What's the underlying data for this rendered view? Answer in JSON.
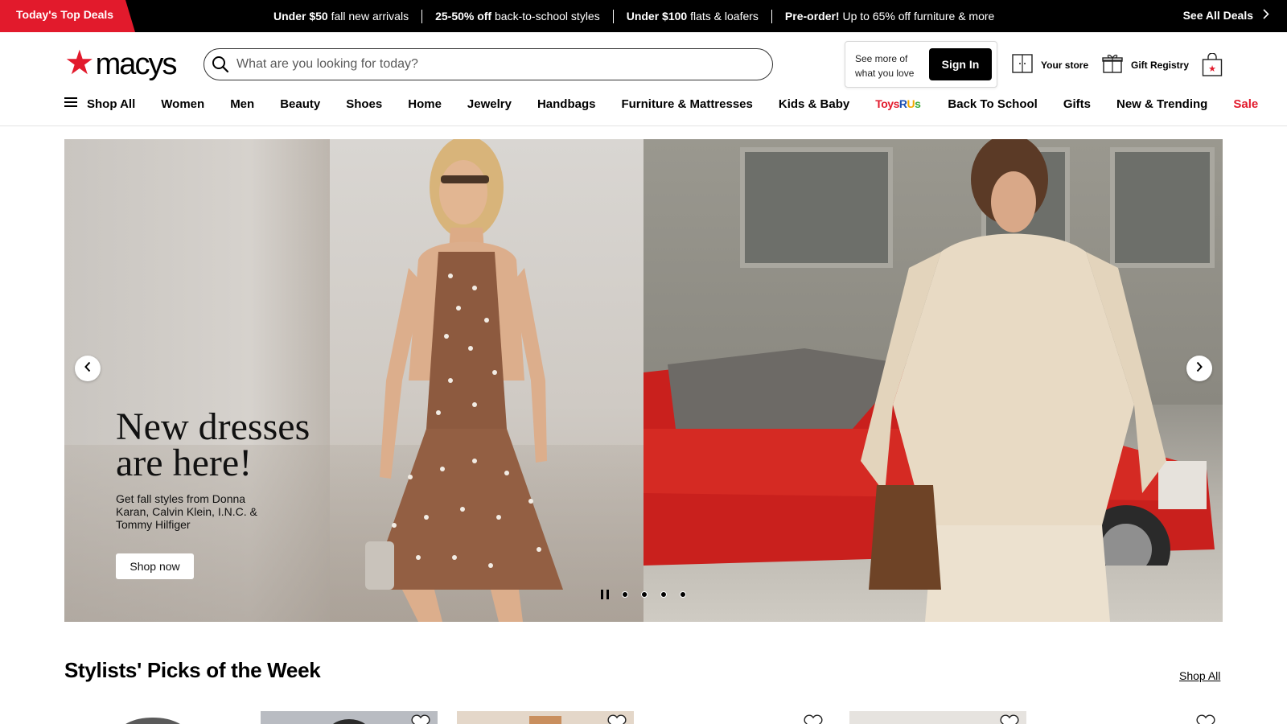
{
  "promo": {
    "tag": "Today's Top Deals",
    "deals": [
      {
        "bold": "Under $50",
        "rest": " fall new arrivals"
      },
      {
        "bold": "25-50% off",
        "rest": " back-to-school styles"
      },
      {
        "bold": "Under $100",
        "rest": " flats & loafers"
      },
      {
        "bold": "Pre-order!",
        "rest": " Up to 65% off furniture & more"
      }
    ],
    "see_all": "See All Deals"
  },
  "header": {
    "logo_text": "macys",
    "search_placeholder": "What are you looking for today?",
    "signin_prompt": "See more of what you love",
    "signin_label": "Sign In",
    "store_label": "Your store",
    "registry_label": "Gift Registry"
  },
  "nav": {
    "shop_all": "Shop All",
    "items": [
      "Women",
      "Men",
      "Beauty",
      "Shoes",
      "Home",
      "Jewelry",
      "Handbags",
      "Furniture & Mattresses",
      "Kids & Baby"
    ],
    "toys": [
      "Toys",
      "R",
      "U",
      "s"
    ],
    "items2": [
      "Back To School",
      "Gifts",
      "New & Trending"
    ],
    "sale": "Sale"
  },
  "hero": {
    "title": "New dresses are here!",
    "subtitle": "Get fall styles from Donna Karan, Calvin Klein, I.N.C. & Tommy Hilfiger",
    "cta": "Shop now",
    "slide_count": 4,
    "active_slide": 1
  },
  "picks": {
    "title": "Stylists' Picks of the Week",
    "shop_all": "Shop All"
  },
  "colors": {
    "brand_red": "#e21a2c",
    "black": "#000000"
  }
}
